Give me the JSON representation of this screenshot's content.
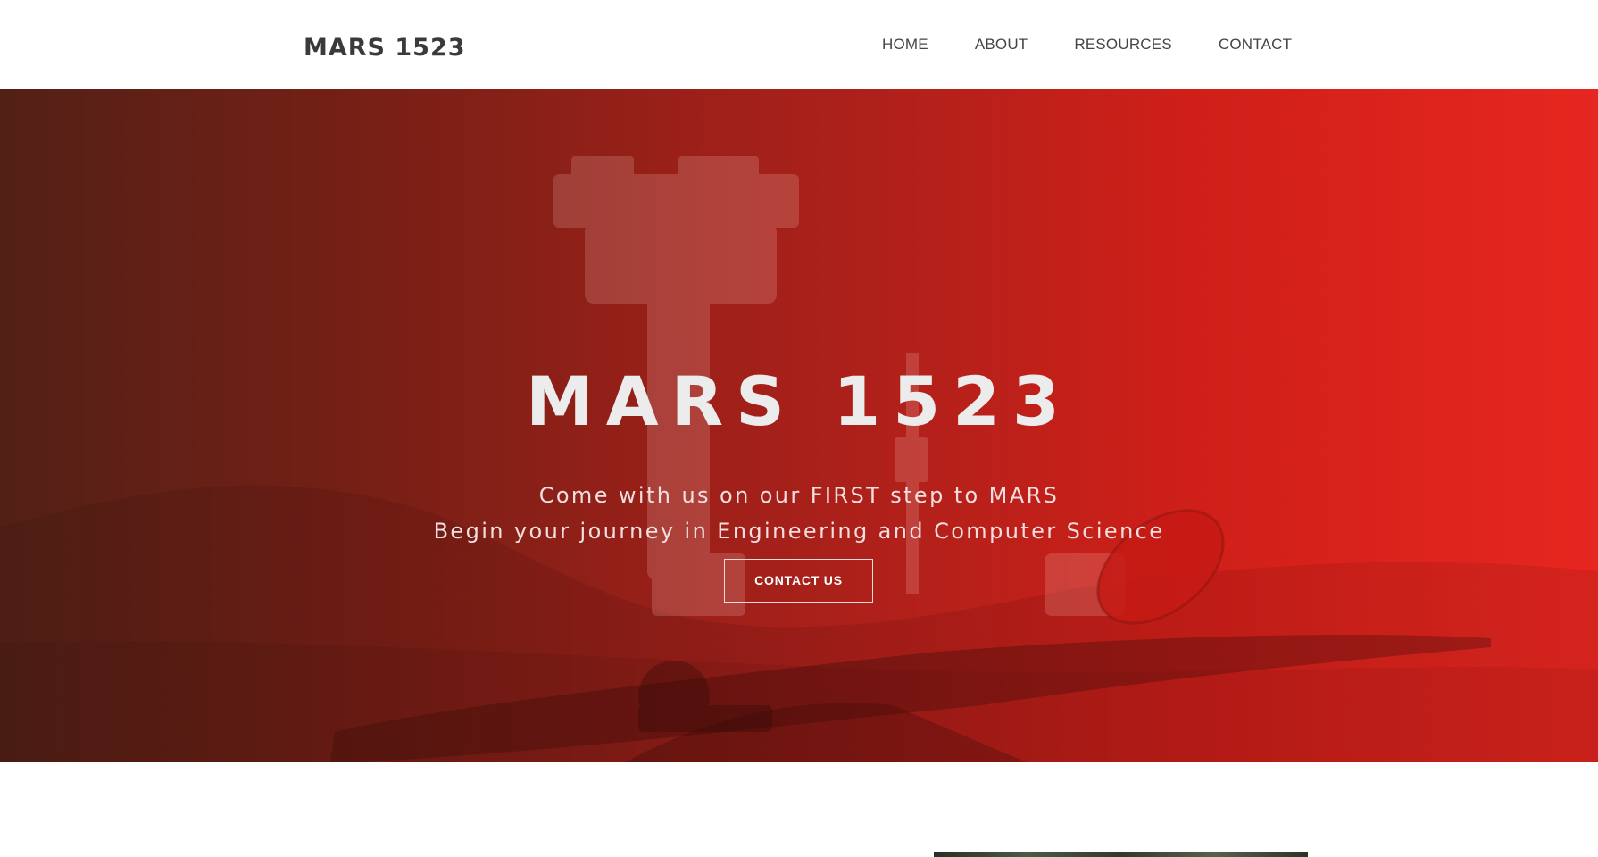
{
  "navbar": {
    "brand": "MARS 1523",
    "links": [
      "HOME",
      "ABOUT",
      "RESOURCES",
      "CONTACT"
    ]
  },
  "hero": {
    "title": "MARS 1523",
    "subtitle_line1": "Come with us on our FIRST step to MARS",
    "subtitle_line2": "Begin your journey in Engineering and Computer Science",
    "cta_label": "CONTACT US",
    "background_image": "mars-rover-photo",
    "overlay_colors": [
      "#5a2418",
      "#a8201a",
      "#e3261f"
    ]
  },
  "colors": {
    "brand_text": "#3a3a3a",
    "nav_text": "#444444",
    "hero_text": "#ececec"
  }
}
